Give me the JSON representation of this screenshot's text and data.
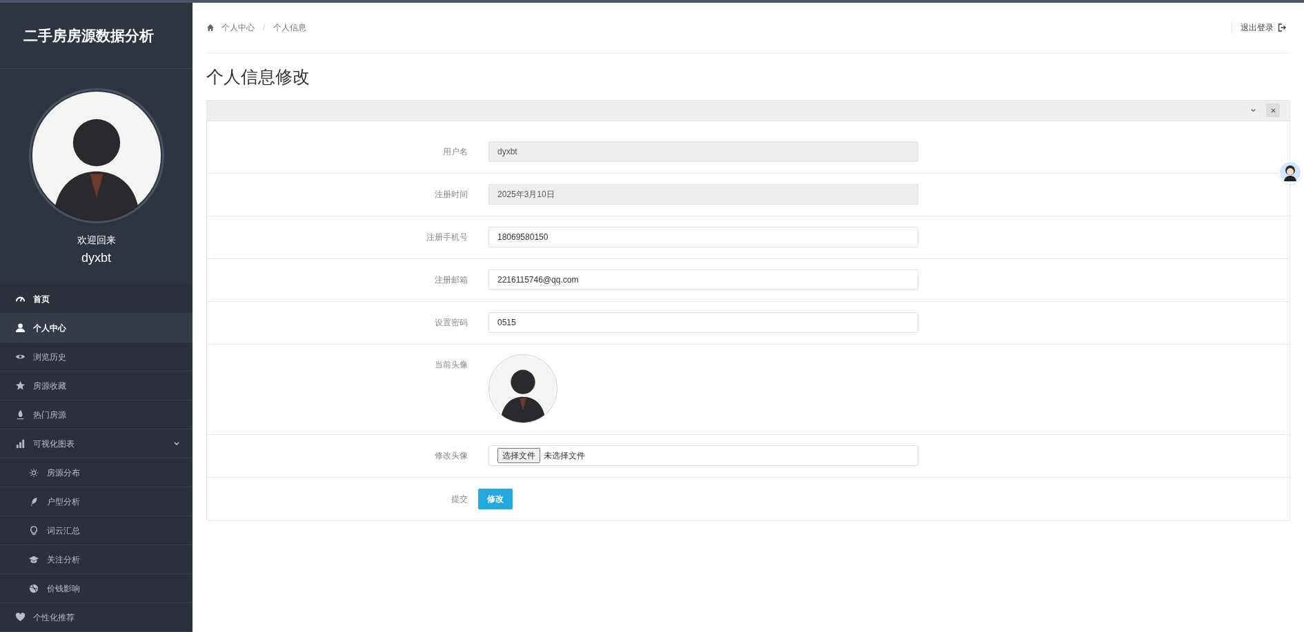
{
  "sidebar": {
    "title": "二手房房源数据分析",
    "welcome": "欢迎回来",
    "username": "dyxbt",
    "items": [
      {
        "label": "首页",
        "emphasized": true,
        "selected": false
      },
      {
        "label": "个人中心",
        "emphasized": true,
        "selected": true
      },
      {
        "label": "浏览历史",
        "emphasized": false,
        "selected": false
      },
      {
        "label": "房源收藏",
        "emphasized": false,
        "selected": false
      },
      {
        "label": "热门房源",
        "emphasized": false,
        "selected": false
      },
      {
        "label": "可视化图表",
        "emphasized": false,
        "selected": false,
        "expanded": true,
        "children": [
          {
            "label": "房源分布",
            "selected": false
          },
          {
            "label": "户型分析",
            "selected": false
          },
          {
            "label": "词云汇总",
            "selected": false
          },
          {
            "label": "关注分析",
            "selected": false
          },
          {
            "label": "价钱影响",
            "selected": false
          }
        ]
      },
      {
        "label": "个性化推荐",
        "emphasized": false,
        "selected": false
      }
    ]
  },
  "breadcrumb": [
    "个人中心",
    "/",
    "个人信息"
  ],
  "logout": "退出登录",
  "page_title": "个人信息修改",
  "form": [
    {
      "kind": "readonly",
      "label": "用户名",
      "value": "dyxbt"
    },
    {
      "kind": "readonly",
      "label": "注册时间",
      "value": "2025年3月10日"
    },
    {
      "kind": "text",
      "label": "注册手机号",
      "value": "18069580150"
    },
    {
      "kind": "text",
      "label": "注册邮箱",
      "value": "2216115746@qq.com"
    },
    {
      "kind": "text",
      "label": "设置密码",
      "value": "0515"
    },
    {
      "kind": "avatar",
      "label": "当前头像"
    },
    {
      "kind": "file",
      "label": "修改头像",
      "button": "选择文件",
      "status": "未选择文件"
    },
    {
      "kind": "submit",
      "label": "提交",
      "button": "修改"
    }
  ]
}
